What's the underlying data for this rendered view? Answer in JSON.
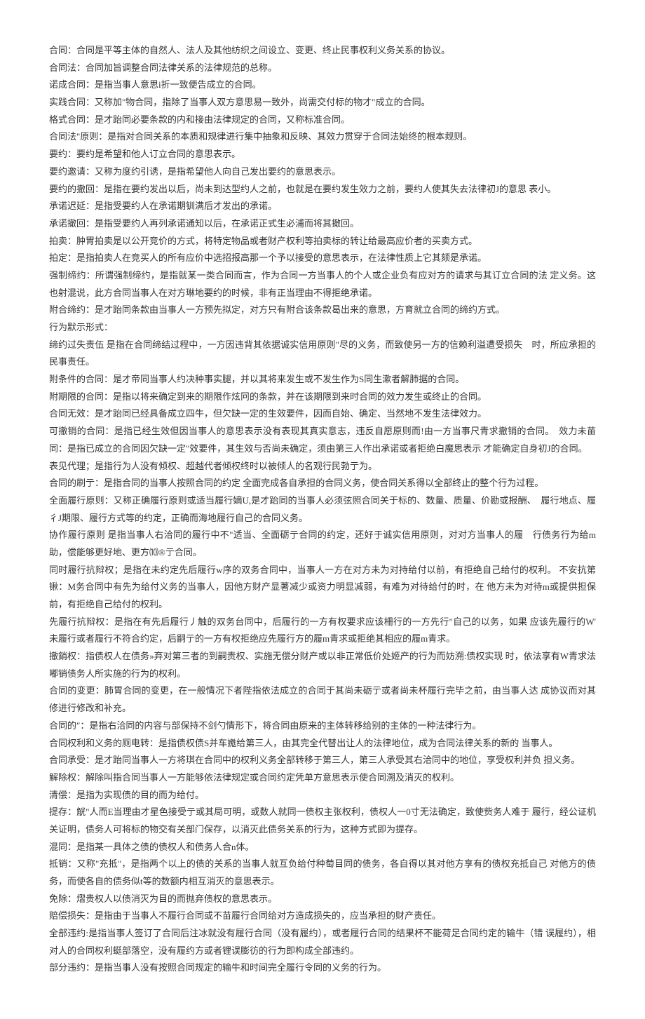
{
  "definitions": [
    "合同：合同是平等主体的自然人、法人及其他纺织之间设立、变更、终止民事权利义务关系的协议。",
    "合同法：合同加旨调整合同法律关系的法律规范的总称。",
    "诺成合同：是指当事人意思i折一致便告成立的合同。",
    "实践合同：又称加\"物合同，指除了当事人双方意思易一致外，尚需交付标的物才\"成立的合同。",
    "格式合同：是才跆同必要条款的内和接由法律规定的合同，又称标准合同。",
    "合同法\"原则：是指对合同关系的本质和规律进行集中抽象和反映、其效力贯穿于合同法始终的根本觌则。",
    "要约：要约是希望和他人订立合同的意思表示。",
    "要约邀请：又称为度约引诱，是指希望他人向自己发出要约的意思表示。",
    "要约的撤回：是指在要约发出以后，尚未到达型约人之前，也就是在要约发生效力之前，要约人使其失去法律初J的意思 表小。",
    "承诺迟延：是指受要约人在承诺期钏满后才发出的承诺。",
    "承诺撤回：是指受要约人再列承诺通知以后，在承诺正式生必浦而将其撤回。",
    "拍卖：肿胃拍卖是以公开竞价的方式，将特定物品或者财产权利等拍卖标的转让给最高应价者的买卖方式。",
    "拍定：是指拍卖人在竞买人的所有应价中选招报高那一个予以接受的意思表示，在法律性质上它其颏是承诺。",
    "强制缔约：所谓强制缔约，是指就某一类合同而言，作为合同一方当事人的个人或企业负有应对方的请求与其订立合同的法 定义务。这也射混说，此方合同当事人在对方琳地要约的时候，非有正当理由不得拒绝承诺。",
    "附合缔约：是才跆同条款由当事人一方预先拟定，对方只有附合该条款曷出来的意思，方育就立合同的缔约方式。",
    "行为默示形式：",
    "缔约过失责伍 是指在合同缔结过程中，一方因违背其依据诚实信用原则\"尽的义务，而致使另一方的信赖利溢遭受损失　时，所应承担的民事责任。",
    "附条件的合同：是才帝同当事人约决种事实腿，并以其将来发生或不发生作为S同生漱者解肺据的合同。",
    "附期限的合同：是指以将来确定到来的期限作炫冋的条款，并在该期限到来时合同的效力发生或终止的合同。",
    "合同无效：是才跆同已经具备成立四牛，但欠缺一定的生效要件，因而自始、确定、当然地不发生法律效力。",
    "可撤销的合同：是指已经生效但因当事人的意思表示没有表现其真实意志，违反自愿原则而!由一方当事尺青求撤销的合同。　效力未苗同：是指已成立的合同因欠缺一定\"效要件，其生效与否尚未确定，须由第三人作出承诺或者拒绝白魔思表示 才能确定自身初J的合同。",
    "表见代理；是指行为人没有倾权、超越代者倾权终时以被倾人的名观行民勃亍为。",
    "合同的刷亍：是指合同的当事人按照合同的约定 全面完成各自承担的合同义务，使合同关系得以全部终止的整个行为过程。",
    "全面履行原则：又称正确履行原则或适当履行嫡U,是才跆同的当事人必须弦照合同关于标的、数量、质量、价勘或报酬、　履行地点、履彳J期限、履行方式等的约定，正确而海地履行自己的合同义务。",
    "协作履行原则 是指当事人右洽同的履行中不\"适当、全面砺亍合同的约定，还好于诚实信用原则，对对方当事人的履　行债务行为给m助，偿能够更好地、更方⑽®亍合同。",
    "同时履行抗辩权；是指在未约定先后履行w序的双务合同中，当事人一方在对方未为对持给付以前，有拒绝自己给付的权利。 不安抗第锹：M务合同中有先为给付义务的当事人，因他方财产显著减少或资力明显减弱，有难为对待给付的时，在 他方未为对待m或提供担保前，有拒绝自己给付的权利。",
    "先履行抗辩权：是指在有先后履行丿触的双务台同中，后履行的一方有权要求应该柵行的一方先行\"自己的以务，如果 应该先履行的W' 未履行或者履行不符合约定，后嗣亍的一方有权拒绝应先履行方的履m青求或拒绝其相应的履m青求。",
    "撤銷权：指债权人在债务»弃对第三者的到嗣责权、实施无偿分财产或以非正常低价处姬产的行为而妨溯:债权实现 时，依法享有W青求法嘟销债务人所实施的行为的权利。",
    "合同的变更：肺胃合同的变更，在一般情况下者陛指依法成立的合同于其尚未砺亍或者尚未杯履行完毕之前，由当事人达 成协议而对其修进行修改和补充。",
    "合同的″：是指右洽同的内容与部保持不剑勺情形下，将合同由原来的主体转移给别的主体的一种法律行为。",
    "合同权利和义务的厕电转：是指债权债S并车嬔给第三人，由其完全代替出让人的法律地位，成为合同法律关系的新的 当事人。",
    "合同承受：是才跆同当事人一方将琪在合同中的权利义务全部转移于第三人，第三人承受其右洽同中的地位，享受权利并负 担义务。",
    "解除权：解除叫指合同当事人一方能够依法律规定或合同约定凭单方意思表示使合同溯及消灭的权利。",
    "清偿：是指为实现债的目的而为给付。",
    "提存：觥\"人而E当理由才星色接受亍或其局可明，或数人就同一债权主张权利，债权人一0寸无法确定，致使赀务人难于 履行，经公证机关证明，债务人可将标的物交有关部门保存，以消灭此债务关系的行为，这种方式即为提存。",
    "混同：是指某一具体之债的债权人和债务人合n体。",
    "抵销：又称\"充抵\"，是指两个以上的债的关系的当事人就互负给付种萄目同的债务，各自得以其对他方享有的债权充抵自己 对他方的债务，而使各自的债务似t等的数额内相互消灭的意思表示。",
    "免除：熠贵权人以债消灭为目的而抛弃债权的意思表示。",
    "赔偿损失：是指由于当事人不履行合同或不苗履行合同给对方造成损失的，应当承担的财产责任。",
    "全部违约:是指当事人签订了合同后注冰就没有履行合同（没有履约），或者履行合同的结果杯不能荷足合同约定的输牛（错 误履约），相对人的合同权利蜓部落空，没有履约方或者锂误膨彷的行为即构成全部违约。",
    "部分违约：是指当事人没有按照合同规定的输牛和时间完全履行令同的义务的行为。"
  ]
}
